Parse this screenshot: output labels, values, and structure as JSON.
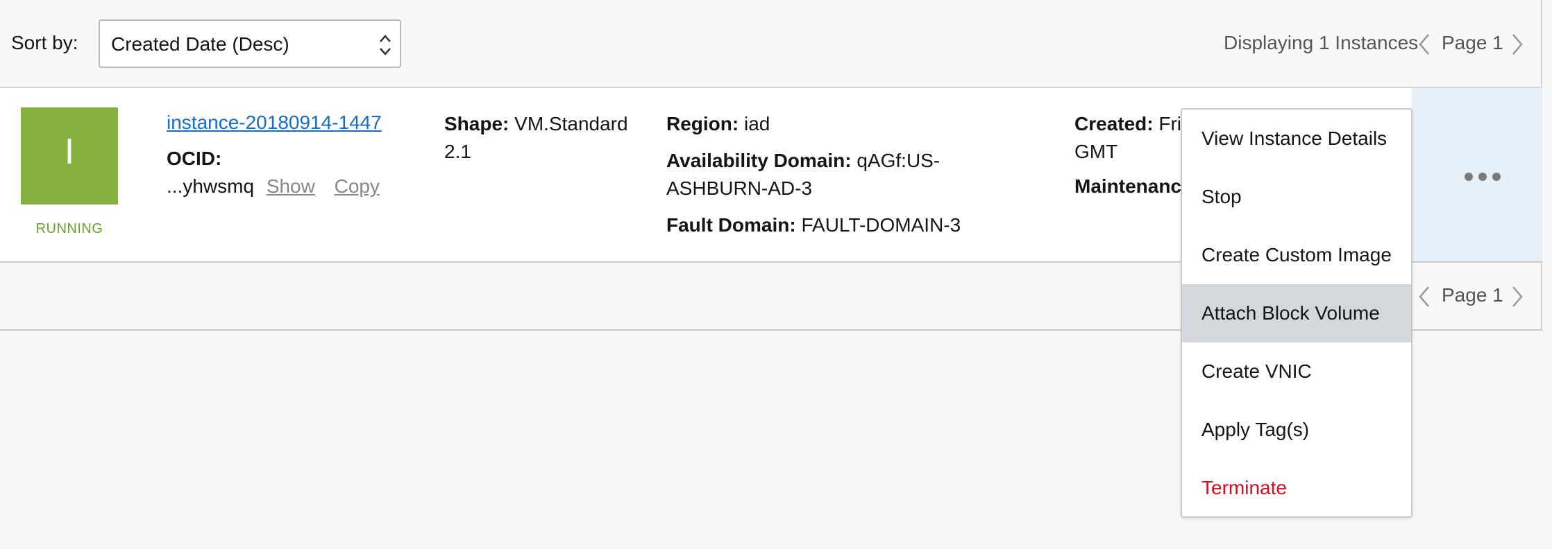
{
  "sort": {
    "label": "Sort by:",
    "selected": "Created Date (Desc)"
  },
  "pagination": {
    "summary": "Displaying 1 Instances",
    "page": "Page 1",
    "page_bottom": "Page 1"
  },
  "instance": {
    "status_letter": "I",
    "status": "RUNNING",
    "name": "instance-20180914-1447",
    "ocid_label": "OCID:",
    "ocid_value": "...yhwsmq",
    "show_label": "Show",
    "copy_label": "Copy",
    "shape_label": "Shape:",
    "shape_line1": "VM.Standard",
    "shape_line2": "2.1",
    "region_label": "Region:",
    "region_value": "iad",
    "ad_label": "Availability Domain:",
    "ad_line1": "qAGf:US-",
    "ad_line2": "ASHBURN-AD-3",
    "fd_label": "Fault Domain:",
    "fd_value": "FAULT-DOMAIN-3",
    "created_label": "Created:",
    "created_value_partial": "Fri",
    "created_line2": "GMT",
    "maintenance_partial": "Maintenanc"
  },
  "menu": {
    "items": [
      "View Instance Details",
      "Stop",
      "Create Custom Image",
      "Attach Block Volume",
      "Create VNIC",
      "Apply Tag(s)",
      "Terminate"
    ],
    "highlighted": "Attach Block Volume"
  },
  "colors": {
    "running": "#84b13d",
    "link": "#1a6bc6",
    "danger": "#d0101f",
    "highlight": "#d4d7dc",
    "actions_cell": "#e6f0f9"
  }
}
